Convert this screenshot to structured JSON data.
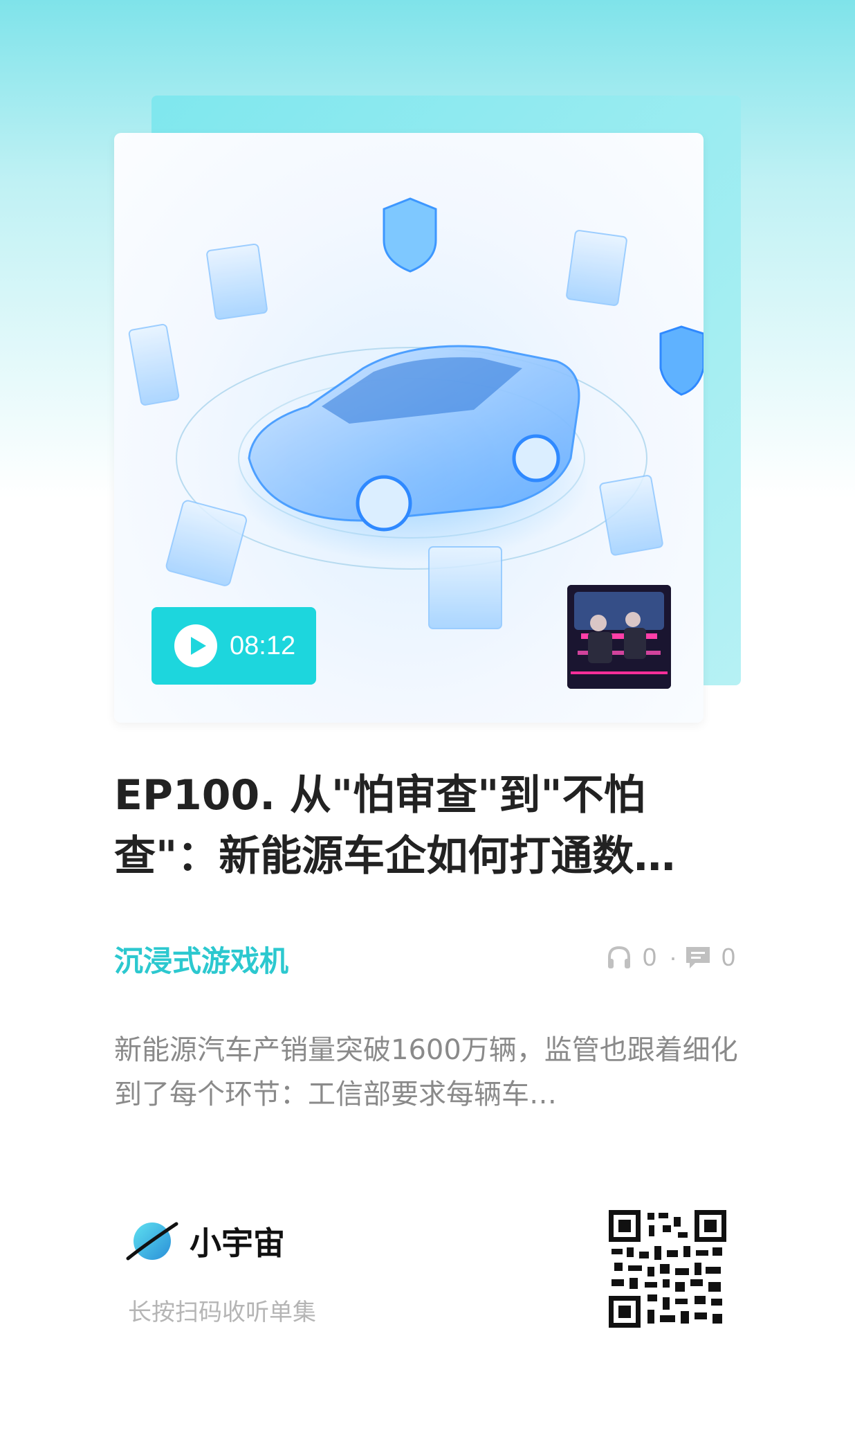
{
  "cover": {
    "duration": "08:12",
    "colors": {
      "accent": "#1dd6dd",
      "cover_back": "#7fe7ee"
    }
  },
  "episode": {
    "title": "EP100. 从\"怕审查\"到\"不怕查\"：新能源车企如何打通数…"
  },
  "podcast": {
    "name": "沉浸式游戏机",
    "listens": "0",
    "comments": "0",
    "listens_icon": "headphones-icon",
    "comments_icon": "comment-icon"
  },
  "description": "新能源汽车产销量突破1600万辆，监管也跟着细化到了每个环节：工信部要求每辆车…",
  "footer": {
    "app_name": "小宇宙",
    "scan_hint": "长按扫码收听单集",
    "logo_icon": "planet-icon",
    "qr_icon": "qr-code-icon"
  }
}
